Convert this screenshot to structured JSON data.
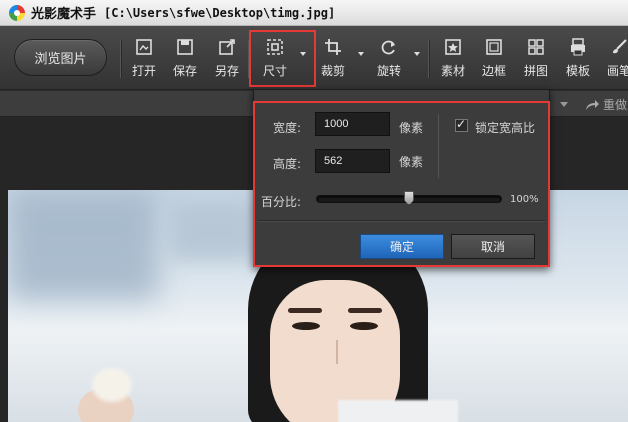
{
  "titlebar": {
    "app_name": "光影魔术手",
    "file_path": "[C:\\Users\\sfwe\\Desktop\\timg.jpg]"
  },
  "toolbar": {
    "browse_label": "浏览图片",
    "tools": [
      {
        "label": "打开",
        "icon": "open-icon"
      },
      {
        "label": "保存",
        "icon": "save-icon"
      },
      {
        "label": "另存",
        "icon": "save-as-icon"
      },
      {
        "label": "尺寸",
        "icon": "resize-icon"
      },
      {
        "label": "裁剪",
        "icon": "crop-icon"
      },
      {
        "label": "旋转",
        "icon": "rotate-icon"
      },
      {
        "label": "素材",
        "icon": "material-icon"
      },
      {
        "label": "边框",
        "icon": "border-icon"
      },
      {
        "label": "拼图",
        "icon": "collage-icon"
      },
      {
        "label": "模板",
        "icon": "template-icon"
      },
      {
        "label": "画笔",
        "icon": "brush-icon"
      }
    ]
  },
  "subbar": {
    "redo_label": "重做"
  },
  "resize_panel": {
    "width_label": "宽度:",
    "width_value": "1000",
    "height_label": "高度:",
    "height_value": "562",
    "unit": "像素",
    "lock_ratio_label": "锁定宽高比",
    "lock_ratio_checked": true,
    "percent_label": "百分比:",
    "percent_value": "100%",
    "slider_level": 0.5,
    "ok_label": "确定",
    "cancel_label": "取消"
  },
  "colors": {
    "highlight": "#e53935",
    "accent": "#2a78d0"
  }
}
